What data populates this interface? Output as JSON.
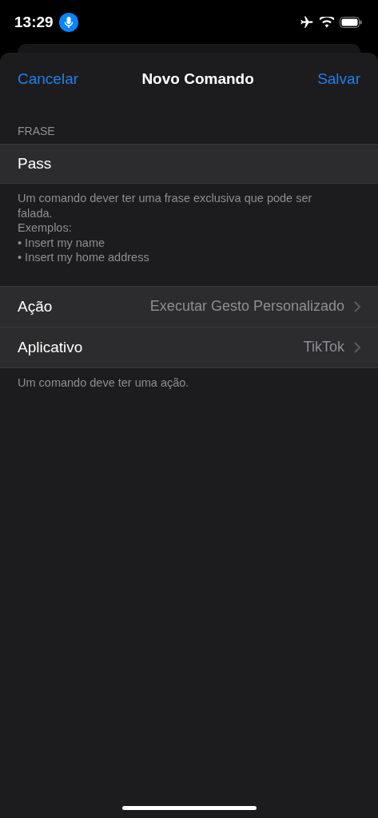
{
  "status_bar": {
    "time": "13:29",
    "mic_active": true
  },
  "nav": {
    "cancel": "Cancelar",
    "title": "Novo Comando",
    "save": "Salvar"
  },
  "phrase_section": {
    "header": "FRASE",
    "field_value": "Pass",
    "footer": [
      "Um comando dever ter uma frase exclusiva que pode ser falada.",
      "Exemplos:",
      "• Insert my name",
      "• Insert my home address"
    ]
  },
  "settings_rows": [
    {
      "label": "Ação",
      "value": "Executar Gesto Personalizado"
    },
    {
      "label": "Aplicativo",
      "value": "TikTok"
    }
  ],
  "settings_footer": "Um comando deve ter uma ação."
}
